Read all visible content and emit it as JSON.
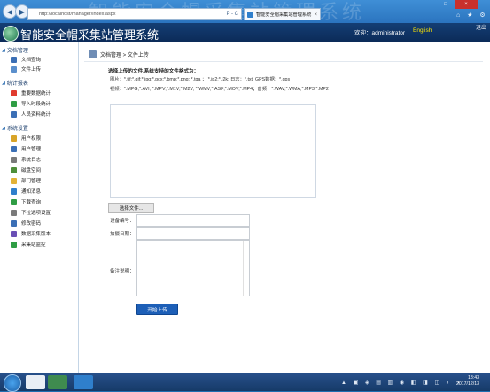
{
  "browser": {
    "url": "http://localhost/manager/index.aspx",
    "tab_title": "智能安全帽采集站管理系统",
    "back_icon": "back-arrow-icon",
    "forward_icon": "forward-arrow-icon",
    "search_controls": "Ρ - C",
    "tab_close": "×",
    "win_min": "–",
    "win_max": "□",
    "win_close": "×",
    "toolbar_icons": "⌂ ★ ⚙"
  },
  "header": {
    "title": "智能安全帽采集站管理系统",
    "welcome": "欢迎：administrator",
    "language": "English",
    "logout": "退出"
  },
  "sidebar": {
    "sections": [
      {
        "label": "文档管理",
        "items": [
          {
            "label": "文档查询",
            "icon": "document-search-icon",
            "color": "#3b6fb5"
          },
          {
            "label": "文件上传",
            "icon": "file-upload-icon",
            "color": "#5b8fcc"
          }
        ]
      },
      {
        "label": "统计报表",
        "items": [
          {
            "label": "重要数据统计",
            "icon": "star-icon",
            "color": "#e03b2f"
          },
          {
            "label": "导入时段统计",
            "icon": "import-icon",
            "color": "#2f9d44"
          },
          {
            "label": "人员资料统计",
            "icon": "people-icon",
            "color": "#3b6fb5"
          }
        ]
      },
      {
        "label": "系统设置",
        "items": [
          {
            "label": "用户权限",
            "icon": "key-icon",
            "color": "#d8a428"
          },
          {
            "label": "用户管理",
            "icon": "user-icon",
            "color": "#3b6fb5"
          },
          {
            "label": "系统日志",
            "icon": "log-icon",
            "color": "#7a7a7a"
          },
          {
            "label": "磁盘空间",
            "icon": "disk-icon",
            "color": "#4e8f3a"
          },
          {
            "label": "部门管理",
            "icon": "folder-icon",
            "color": "#e3b236"
          },
          {
            "label": "通知消息",
            "icon": "message-icon",
            "color": "#2f7fcc"
          },
          {
            "label": "下载查询",
            "icon": "download-icon",
            "color": "#2f9d44"
          },
          {
            "label": "下拉选项设置",
            "icon": "list-icon",
            "color": "#7a7a7a"
          },
          {
            "label": "修改密码",
            "icon": "password-icon",
            "color": "#3b6fb5"
          },
          {
            "label": "数据采集版本",
            "icon": "version-icon",
            "color": "#6a4fb5"
          },
          {
            "label": "采集站监控",
            "icon": "monitor-icon",
            "color": "#2f9d44"
          }
        ]
      }
    ]
  },
  "content": {
    "breadcrumb": "文档管理 > 文件上传",
    "heading": "选择上传的文件,系统支持的文件格式为：",
    "formats": [
      "图片：*.tif;*.gif;*.jpg;*.pcx;*.bmp;*.png; *.tga ； *.jp2;*.j2k; 日志：*.txt; GPS数据：*.gps ;",
      "视频：*.MPG;*.AVI; *.MPV;*.M1V;*.M2V; *.WMV;*.ASF;*.MOV;*.MP4；音频：*.WAV;*.WMA;*.MP3;*.MP2"
    ],
    "select_file": "选择文件...",
    "device_label": "设备编号：",
    "date_label": "拍摄日期：",
    "remark_label": "备注说明：",
    "upload_button": "开始上传"
  },
  "taskbar": {
    "time": "18:43",
    "date": "2017/12/13",
    "tray_icons": "▲ ▣ ◈ ▤ ▥ ◉ ◧ ◨ ◫ ◐ ◑"
  }
}
